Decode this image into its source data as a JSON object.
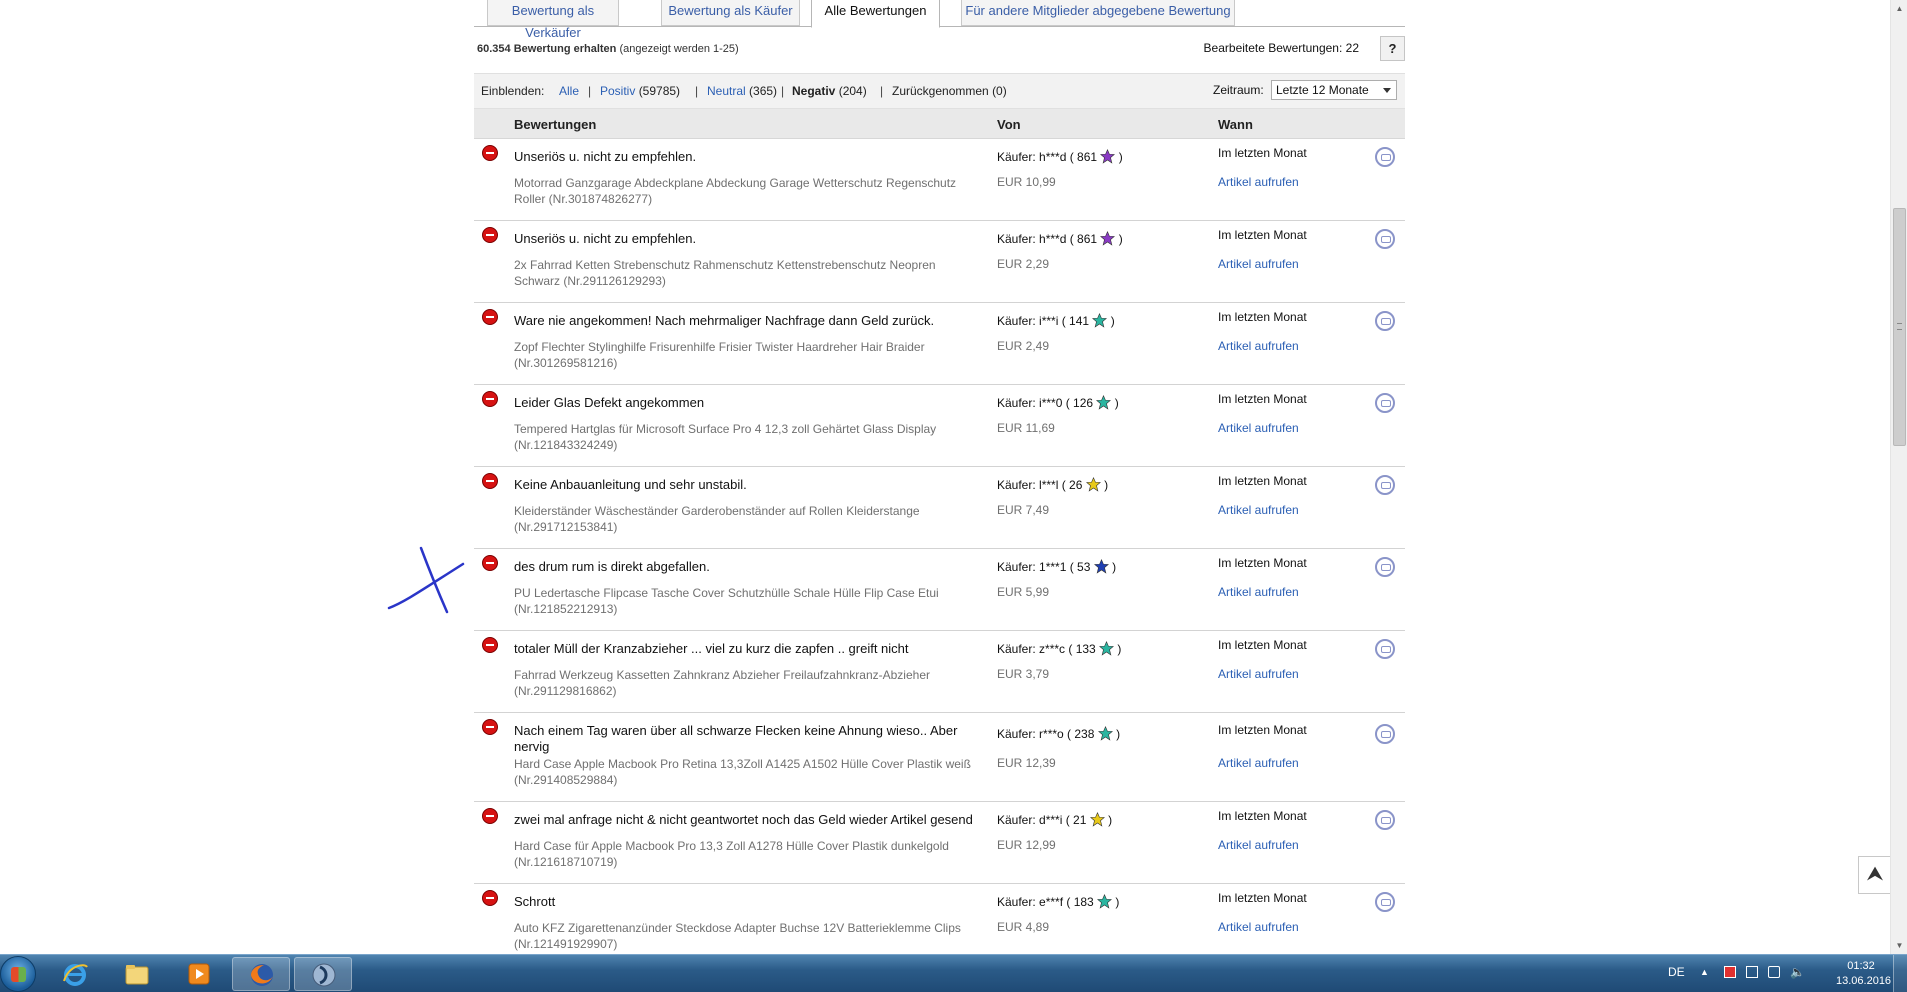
{
  "tabs": [
    {
      "label": "Bewertung als Verkäufer",
      "active": false
    },
    {
      "label": "Bewertung als Käufer",
      "active": false
    },
    {
      "label": "Alle Bewertungen",
      "active": true
    },
    {
      "label": "Für andere Mitglieder abgegebene Bewertung",
      "active": false
    }
  ],
  "summary": {
    "count_bold": "60.354 Bewertung erhalten",
    "count_rest": "(angezeigt werden 1-25)",
    "edited_label": "Bearbeitete Bewertungen: 22",
    "help_label": "?"
  },
  "filter": {
    "show_label": "Einblenden:",
    "all": "Alle",
    "positive_label": "Positiv",
    "positive_count": "(59785)",
    "neutral_label": "Neutral",
    "neutral_count": "(365)",
    "negative_label": "Negativ",
    "negative_count": "(204)",
    "withdrawn_label": "Zurückgenommen",
    "withdrawn_count": "(0)",
    "period_label": "Zeitraum:",
    "period_value": "Letzte 12 Monate"
  },
  "table_header": {
    "ratings": "Bewertungen",
    "from": "Von",
    "when": "Wann"
  },
  "rows": [
    {
      "comment": "Unseriös u. nicht zu empfehlen.",
      "item": "Motorrad Ganzgarage Abdeckplane Abdeckung Garage Wetterschutz Regenschutz Roller (Nr.301874826277)",
      "buyer": "Käufer: h***d ( 861",
      "star_color": "#8a3bc4",
      "price": "EUR 10,99",
      "when": "Im letzten Monat",
      "link": "Artikel aufrufen"
    },
    {
      "comment": "Unseriös u. nicht zu empfehlen.",
      "item": "2x Fahrrad Ketten Strebenschutz Rahmenschutz Kettenstrebenschutz Neopren Schwarz (Nr.291126129293)",
      "buyer": "Käufer: h***d ( 861",
      "star_color": "#8a3bc4",
      "price": "EUR 2,29",
      "when": "Im letzten Monat",
      "link": "Artikel aufrufen"
    },
    {
      "comment": "Ware nie angekommen! Nach mehrmaliger Nachfrage dann Geld zurück.",
      "item": "Zopf Flechter Stylinghilfe Frisurenhilfe Frisier Twister Haardreher Hair Braider (Nr.301269581216)",
      "buyer": "Käufer: i***i ( 141",
      "star_color": "#2ab5a0",
      "price": "EUR 2,49",
      "when": "Im letzten Monat",
      "link": "Artikel aufrufen"
    },
    {
      "comment": "Leider Glas Defekt angekommen",
      "item": "Tempered Hartglas für Microsoft Surface Pro 4 12,3 zoll Gehärtet Glass Display (Nr.121843324249)",
      "buyer": "Käufer: i***0 ( 126",
      "star_color": "#2ab5a0",
      "price": "EUR 11,69",
      "when": "Im letzten Monat",
      "link": "Artikel aufrufen"
    },
    {
      "comment": "Keine Anbauanleitung und sehr unstabil.",
      "item": "Kleiderständer Wäscheständer Garderobenständer auf Rollen Kleiderstange (Nr.291712153841)",
      "buyer": "Käufer: l***l ( 26",
      "star_color": "#e8c91a",
      "price": "EUR 7,49",
      "when": "Im letzten Monat",
      "link": "Artikel aufrufen"
    },
    {
      "comment": "des drum rum is direkt abgefallen.",
      "item": "PU Ledertasche Flipcase Tasche Cover Schutzhülle Schale Hülle Flip Case Etui (Nr.121852212913)",
      "buyer": "Käufer: 1***1 ( 53",
      "star_color": "#1f3fb3",
      "price": "EUR 5,99",
      "when": "Im letzten Monat",
      "link": "Artikel aufrufen"
    },
    {
      "comment": "totaler Müll der Kranzabzieher ... viel zu kurz die zapfen .. greift nicht",
      "item": "Fahrrad Werkzeug Kassetten Zahnkranz Abzieher Freilaufzahnkranz-Abzieher (Nr.291129816862)",
      "buyer": "Käufer: z***c ( 133",
      "star_color": "#2ab5a0",
      "price": "EUR 3,79",
      "when": "Im letzten Monat",
      "link": "Artikel aufrufen"
    },
    {
      "comment": "Nach einem Tag waren über all schwarze Flecken keine Ahnung wieso.. Aber nervig",
      "item": "Hard Case Apple Macbook Pro Retina 13,3Zoll A1425 A1502 Hülle Cover Plastik weiß (Nr.291408529884)",
      "buyer": "Käufer: r***o ( 238",
      "star_color": "#2ab5a0",
      "price": "EUR 12,39",
      "when": "Im letzten Monat",
      "link": "Artikel aufrufen"
    },
    {
      "comment": "zwei mal anfrage nicht & nicht geantwortet noch das Geld wieder Artikel gesend",
      "item": "Hard Case für Apple Macbook Pro 13,3 Zoll A1278 Hülle Cover Plastik dunkelgold (Nr.121618710719)",
      "buyer": "Käufer: d***i ( 21",
      "star_color": "#e8c91a",
      "price": "EUR 12,99",
      "when": "Im letzten Monat",
      "link": "Artikel aufrufen"
    },
    {
      "comment": "Schrott",
      "item": "Auto KFZ Zigarettenanzünder Steckdose Adapter Buchse 12V Batterieklemme Clips (Nr.121491929907)",
      "buyer": "Käufer: e***f ( 183",
      "star_color": "#2ab5a0",
      "price": "EUR 4,89",
      "when": "Im letzten Monat",
      "link": "Artikel aufrufen"
    }
  ],
  "taskbar": {
    "language": "DE",
    "time": "01:32",
    "date": "13.06.2016",
    "apps": [
      "windows-explorer",
      "internet-explorer",
      "file-explorer",
      "media-player",
      "firefox",
      "vlc-like-app"
    ]
  }
}
